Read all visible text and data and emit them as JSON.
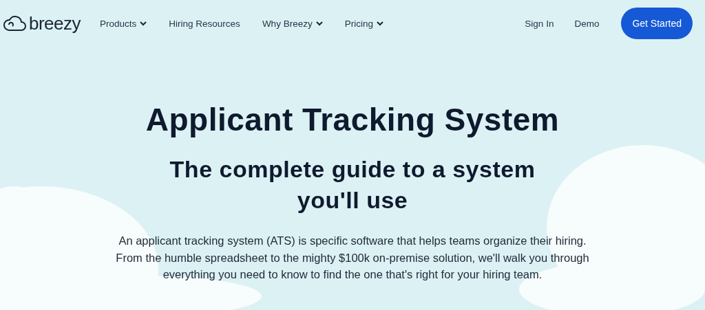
{
  "header": {
    "logo_text": "breezy",
    "nav": [
      {
        "label": "Products",
        "has_menu": true
      },
      {
        "label": "Hiring Resources",
        "has_menu": false
      },
      {
        "label": "Why Breezy",
        "has_menu": true
      },
      {
        "label": "Pricing",
        "has_menu": true
      }
    ],
    "links": [
      "Sign In",
      "Demo"
    ],
    "cta": "Get Started"
  },
  "hero": {
    "title": "Applicant Tracking System",
    "subtitle": "The complete guide to a system you'll use",
    "intro": "An applicant tracking system (ATS) is specific software that helps teams organize their hiring. From the humble spreadsheet to the mighty $100k on-premise solution, we'll walk you through everything you need to know to find the one that's right for your hiring team."
  }
}
